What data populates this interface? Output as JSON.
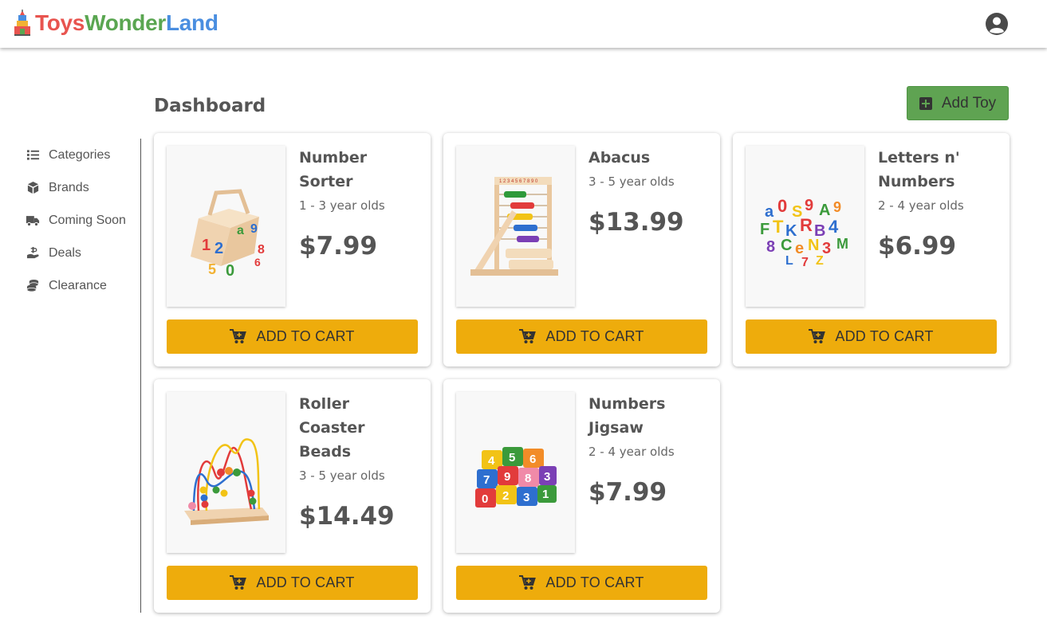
{
  "app": {
    "brand": [
      "Toys",
      "Wonder",
      "Land"
    ],
    "logo_icon": "toy-tower-icon",
    "user_icon": "account-circle-icon"
  },
  "sidebar": {
    "items": [
      {
        "label": "Categories",
        "icon": "list-icon"
      },
      {
        "label": "Brands",
        "icon": "box-icon"
      },
      {
        "label": "Coming Soon",
        "icon": "truck-icon"
      },
      {
        "label": "Deals",
        "icon": "hand-coin-icon"
      },
      {
        "label": "Clearance",
        "icon": "coins-stack-icon"
      }
    ]
  },
  "main": {
    "title": "Dashboard",
    "add_button": "Add Toy",
    "add_icon": "plus-square-icon",
    "cart_label": "ADD TO CART",
    "cart_icon": "cart-plus-icon",
    "products": [
      {
        "name": "Number Sorter",
        "age": "1 - 3 year olds",
        "price": "$7.99"
      },
      {
        "name": "Abacus",
        "age": "3 - 5 year olds",
        "price": "$13.99"
      },
      {
        "name": "Letters n' Numbers",
        "age": "2 - 4 year olds",
        "price": "$6.99"
      },
      {
        "name": "Roller Coaster Beads",
        "age": "3 - 5 year olds",
        "price": "$14.49"
      },
      {
        "name": "Numbers Jigsaw",
        "age": "2 - 4 year olds",
        "price": "$7.99"
      }
    ]
  },
  "colors": {
    "brand_red": "#e8544f",
    "brand_green": "#5aa651",
    "brand_blue": "#4a8ee0",
    "add_button": "#5fa352",
    "cart_button": "#eeac0c"
  }
}
